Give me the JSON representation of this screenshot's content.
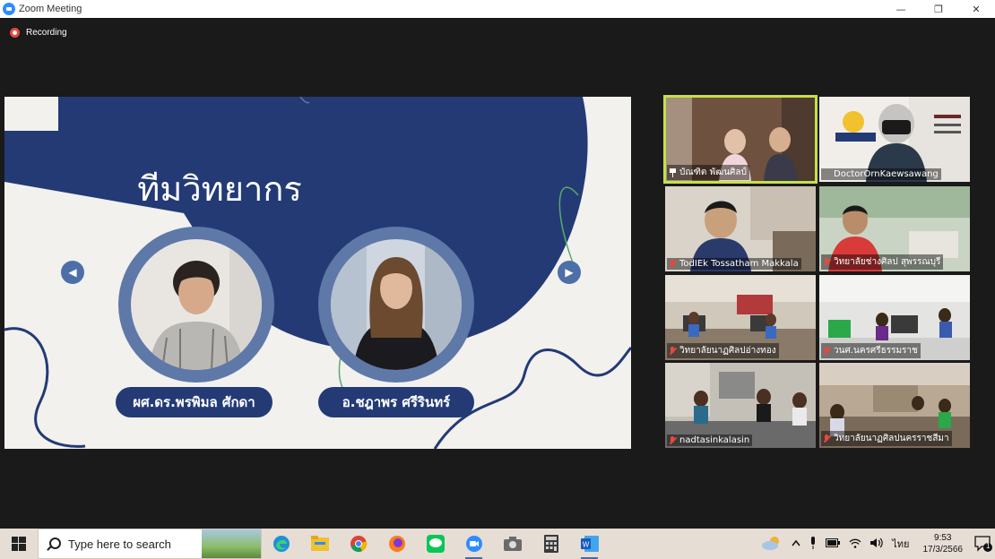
{
  "window": {
    "title": "Zoom Meeting",
    "controls": {
      "minimize": "—",
      "restore": "❐",
      "close": "✕"
    }
  },
  "recording": {
    "label": "Recording"
  },
  "slide": {
    "heading": "ทีมวิทยากร",
    "speakers": [
      {
        "name": "ผศ.ดร.พรพิมล ศักดา"
      },
      {
        "name": "อ.ชฎาพร ศรีรินทร์"
      }
    ],
    "prev_arrow": "◀",
    "next_arrow": "▶",
    "colors": {
      "navy": "#233a75",
      "ring": "#5e78a8",
      "background": "#f2f1ee"
    }
  },
  "gallery": {
    "tiles": [
      {
        "name": "บัณฑิต พัฒนศิลป์",
        "status": "pinned",
        "active": true
      },
      {
        "name": "DoctorOrnKaewsawang",
        "status": "none",
        "active": false
      },
      {
        "name": "TodIEk Tossatham Makkala",
        "status": "muted",
        "active": false
      },
      {
        "name": "วิทยาลัยช่างศิลป สุพรรณบุรี",
        "status": "muted",
        "active": false
      },
      {
        "name": "วิทยาลัยนาฏศิลปอ่างทอง",
        "status": "muted",
        "active": false
      },
      {
        "name": "วนศ.นครศรีธรรมราช",
        "status": "muted",
        "active": false
      },
      {
        "name": "nadtasinkalasin",
        "status": "muted",
        "active": false
      },
      {
        "name": "วิทยาลัยนาฏศิลปนครราชสีมา",
        "status": "muted",
        "active": false
      }
    ]
  },
  "taskbar": {
    "search_placeholder": "Type here to search",
    "apps": [
      "edge-icon",
      "file-explorer-icon",
      "chrome-icon",
      "firefox-icon",
      "line-icon",
      "zoom-icon",
      "camera-icon",
      "calculator-icon",
      "word-icon"
    ],
    "tray": {
      "language": "ไทย",
      "time": "9:53",
      "date": "17/3/2566",
      "notification_count": "1"
    }
  }
}
